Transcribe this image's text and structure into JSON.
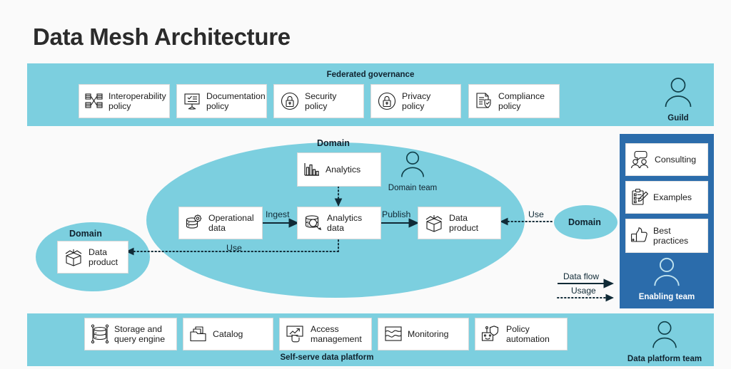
{
  "page": {
    "title": "Data Mesh Architecture",
    "background_color": "#fafafa",
    "teal": "#7ccfdf",
    "blue": "#2b6cab",
    "ink": "#10222e"
  },
  "governance": {
    "band_title": "Federated governance",
    "cards": [
      {
        "icon": "interoperability-icon",
        "label": "Interoperability\npolicy"
      },
      {
        "icon": "documentation-icon",
        "label": "Documentation\npolicy"
      },
      {
        "icon": "security-lock-icon",
        "label": "Security\npolicy"
      },
      {
        "icon": "privacy-lock-icon",
        "label": "Privacy\npolicy"
      },
      {
        "icon": "compliance-shield-icon",
        "label": "Compliance\npolicy"
      }
    ],
    "team": {
      "icon": "person-icon",
      "label": "Guild"
    }
  },
  "domain_main": {
    "label": "Domain",
    "team": {
      "icon": "person-icon",
      "label": "Domain team"
    },
    "nodes": [
      {
        "icon": "analytics-chart-icon",
        "label": "Analytics"
      },
      {
        "icon": "operational-data-icon",
        "label": "Operational\ndata"
      },
      {
        "icon": "analytics-data-icon",
        "label": "Analytics\ndata"
      },
      {
        "icon": "data-product-box-icon",
        "label": "Data\nproduct"
      }
    ],
    "flow_labels": {
      "ingest": "Ingest",
      "publish": "Publish",
      "use_left": "Use",
      "use_right": "Use"
    }
  },
  "domain_left": {
    "label": "Domain",
    "node": {
      "icon": "data-product-box-icon",
      "label": "Data\nproduct"
    }
  },
  "domain_right": {
    "label": "Domain"
  },
  "enabling_team": {
    "cards": [
      {
        "icon": "consulting-people-icon",
        "label": "Consulting"
      },
      {
        "icon": "examples-clipboard-icon",
        "label": "Examples"
      },
      {
        "icon": "thumbs-up-icon",
        "label": "Best\npractices"
      }
    ],
    "team": {
      "icon": "person-icon",
      "label": "Enabling team"
    }
  },
  "platform": {
    "band_title": "Self-serve data platform",
    "cards": [
      {
        "icon": "storage-query-icon",
        "label": "Storage and\nquery engine"
      },
      {
        "icon": "catalog-folder-icon",
        "label": "Catalog"
      },
      {
        "icon": "access-management-icon",
        "label": "Access\nmanagement"
      },
      {
        "icon": "monitoring-waves-icon",
        "label": "Monitoring"
      },
      {
        "icon": "policy-automation-robot-icon",
        "label": "Policy\nautomation"
      }
    ],
    "team": {
      "icon": "person-icon",
      "label": "Data platform team"
    }
  },
  "legend": {
    "data_flow": "Data flow",
    "usage": "Usage"
  }
}
